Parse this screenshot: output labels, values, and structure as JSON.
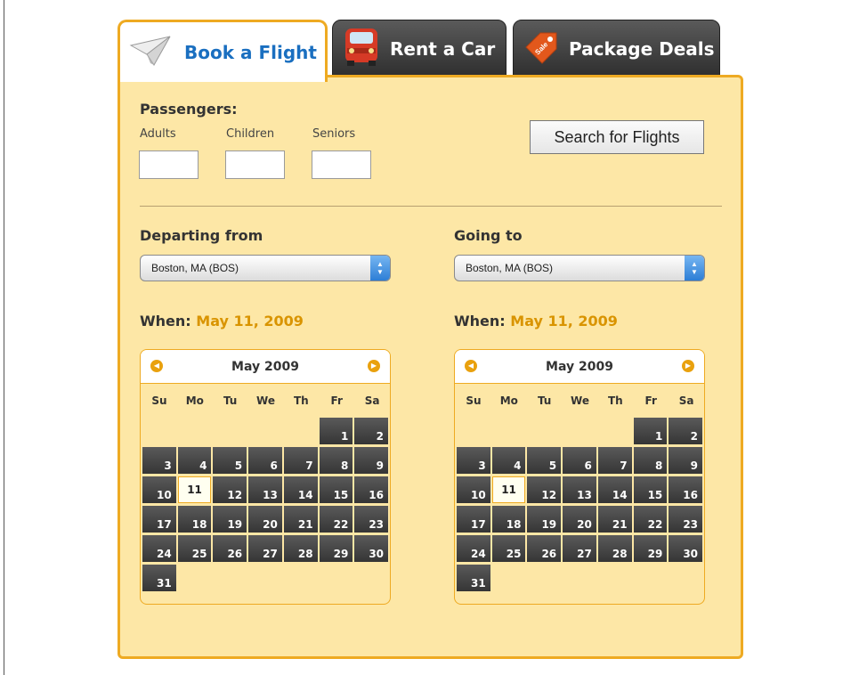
{
  "tabs": [
    {
      "label": "Book a Flight",
      "icon": "paper-plane-icon",
      "active": true
    },
    {
      "label": "Rent a Car",
      "icon": "car-icon",
      "active": false
    },
    {
      "label": "Package Deals",
      "icon": "sale-tag-icon",
      "active": false
    }
  ],
  "passengers": {
    "heading": "Passengers:",
    "adults_label": "Adults",
    "children_label": "Children",
    "seniors_label": "Seniors",
    "adults_value": "",
    "children_value": "",
    "seniors_value": ""
  },
  "search_button": "Search for Flights",
  "departing": {
    "label": "Departing from",
    "selected": "Boston, MA (BOS)",
    "when_label": "When:",
    "when_date": "May 11, 2009",
    "calendar": {
      "month": "May 2009",
      "selected_day": 11
    }
  },
  "going": {
    "label": "Going to",
    "selected": "Boston, MA (BOS)",
    "when_label": "When:",
    "when_date": "May 11, 2009",
    "calendar": {
      "month": "May 2009",
      "selected_day": 11
    }
  },
  "weekdays": [
    "Su",
    "Mo",
    "Tu",
    "We",
    "Th",
    "Fr",
    "Sa"
  ],
  "month_grid": [
    [
      null,
      null,
      null,
      null,
      null,
      1,
      2
    ],
    [
      3,
      4,
      5,
      6,
      7,
      8,
      9
    ],
    [
      10,
      11,
      12,
      13,
      14,
      15,
      16
    ],
    [
      17,
      18,
      19,
      20,
      21,
      22,
      23
    ],
    [
      24,
      25,
      26,
      27,
      28,
      29,
      30
    ],
    [
      31,
      null,
      null,
      null,
      null,
      null,
      null
    ]
  ],
  "colors": {
    "accent": "#eeaa22",
    "panel": "#fde7a6",
    "active_tab_text": "#1a6fc0",
    "date_text": "#d99400"
  }
}
